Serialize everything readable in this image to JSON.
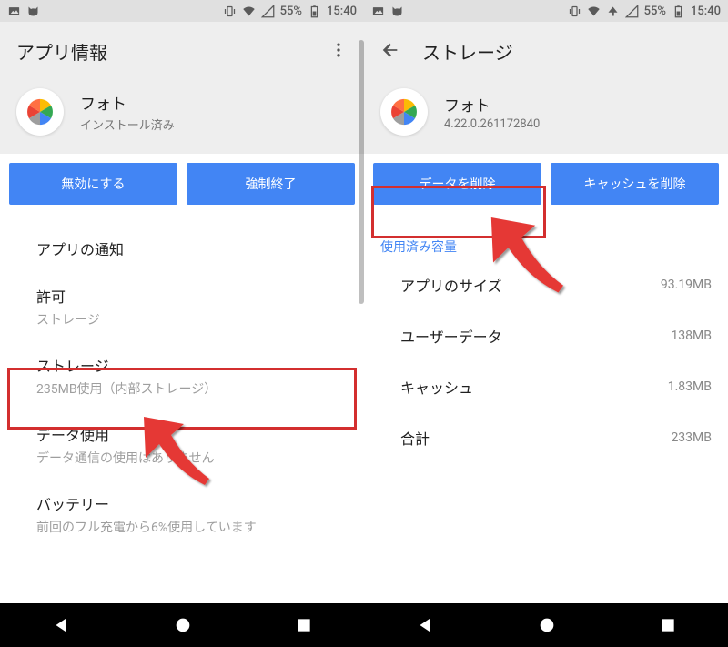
{
  "status": {
    "battery": "55%",
    "time": "15:40"
  },
  "left": {
    "header_title": "アプリ情報",
    "app_name": "フォト",
    "app_sub": "インストール済み",
    "btn_disable": "無効にする",
    "btn_force_stop": "強制終了",
    "items": [
      {
        "title": "アプリの通知",
        "sub": ""
      },
      {
        "title": "許可",
        "sub": "ストレージ"
      },
      {
        "title": "ストレージ",
        "sub": "235MB使用（内部ストレージ）"
      },
      {
        "title": "データ使用",
        "sub": "データ通信の使用はありません"
      },
      {
        "title": "バッテリー",
        "sub": "前回のフル充電から6%使用しています"
      }
    ]
  },
  "right": {
    "header_title": "ストレージ",
    "app_name": "フォト",
    "app_sub": "4.22.0.261172840",
    "btn_clear_data": "データを削除",
    "btn_clear_cache": "キャッシュを削除",
    "section_label": "使用済み容量",
    "rows": [
      {
        "label": "アプリのサイズ",
        "value": "93.19MB"
      },
      {
        "label": "ユーザーデータ",
        "value": "138MB"
      },
      {
        "label": "キャッシュ",
        "value": "1.83MB"
      },
      {
        "label": "合計",
        "value": "233MB"
      }
    ]
  }
}
